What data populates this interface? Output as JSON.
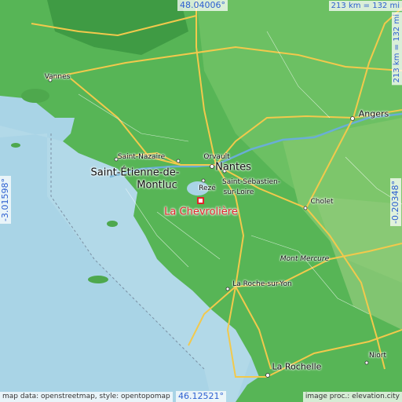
{
  "map": {
    "marker": {
      "label": "La Chevrolière",
      "color": "#e0262b"
    },
    "places": {
      "vannes": "Vannes",
      "saint_nazaire": "Saint-Nazaire",
      "saint_etienne_1": "Saint-Étienne-de-",
      "saint_etienne_2": "Montluc",
      "orvault": "Orvault",
      "nantes": "Nantes",
      "reze": "Rezé",
      "saint_sebastien_1": "Saint-Sébastien-",
      "saint_sebastien_2": "sur-Loire",
      "angers": "Angers",
      "cholet": "Cholet",
      "mont_mercure": "Mont Mercure",
      "la_roche_sur_yon": "La Roche-sur-Yon",
      "niort": "Niort",
      "la_rochelle": "La Rochelle"
    },
    "coordinates": {
      "top_lat": "48.04006°",
      "bottom_lat": "46.12521°",
      "left_lon": "-3.01598°",
      "right_lon": "-0.20348°"
    },
    "scale": {
      "horizontal": "213 km = 132 mi",
      "vertical": "213 km = 132 mi"
    },
    "credits": {
      "left": "map data: openstreetmap, style: opentopomap",
      "right": "image proc.: elevation.city"
    },
    "colors": {
      "sea": "#a9d4e6",
      "land": "#5cb85c",
      "roads": "#f2c94c",
      "coord_text": "#2c5fd1"
    }
  }
}
